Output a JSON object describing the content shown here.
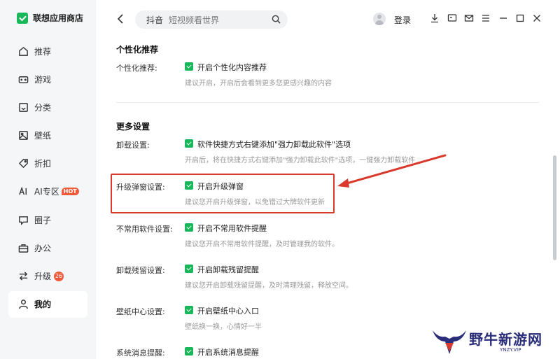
{
  "app": {
    "name": "联想应用商店"
  },
  "sidebar": {
    "items": [
      {
        "label": "推荐",
        "icon": "home-icon"
      },
      {
        "label": "游戏",
        "icon": "gamepad-icon"
      },
      {
        "label": "分类",
        "icon": "category-icon"
      },
      {
        "label": "壁纸",
        "icon": "image-icon"
      },
      {
        "label": "折扣",
        "icon": "tag-icon"
      },
      {
        "label": "AI专区",
        "icon": "ai-icon",
        "badge": "HOT"
      },
      {
        "label": "圈子",
        "icon": "community-icon"
      },
      {
        "label": "办公",
        "icon": "briefcase-icon"
      },
      {
        "label": "升级",
        "icon": "swap-icon",
        "count": "26"
      },
      {
        "label": "我的",
        "icon": "user-icon",
        "active": true
      }
    ]
  },
  "topbar": {
    "search_keyword": "抖音",
    "search_hint": "短视频看世界",
    "login_label": "登录"
  },
  "sections": {
    "personal": {
      "title": "个性化推荐",
      "label": "个性化推荐:",
      "option": "开启个性化内容推荐",
      "hint": "建议开启，开启后会看到更多您更感兴趣的内容"
    },
    "more": {
      "title": "更多设置",
      "rows": [
        {
          "label": "卸载设置:",
          "option": "软件快捷方式右键添加\"强力卸载此软件\"选项",
          "hint": "开启后，将在快捷方式右键添加\"强力卸载此软件\"选项，一键强力卸载软件"
        },
        {
          "label": "升级弹窗设置:",
          "option": "开启升级弹窗",
          "hint": "建议您开启升级弹窗，以免错过大牌软件更新"
        },
        {
          "label": "不常用软件设置:",
          "option": "开启不常用软件提醒",
          "hint": "建议您开启不常用软件提醒，及时管理我的软件。"
        },
        {
          "label": "卸载残留设置:",
          "option": "开启卸载残留提醒",
          "hint": "建议您开启卸载残留提醒，及时清理残留，释放空间。"
        },
        {
          "label": "壁纸中心设置:",
          "option": "开启壁纸中心入口",
          "hint": "壁纸换一换，心情好一半"
        },
        {
          "label": "系统消息提醒:",
          "option": "开启系统消息提醒",
          "hint": ""
        }
      ]
    }
  },
  "watermark": {
    "text": "野牛新游网",
    "sub": "YNZY.VIP"
  },
  "colors": {
    "accent": "#18b85a",
    "annotation": "#d93a2b",
    "badge": "#f05a3a"
  }
}
